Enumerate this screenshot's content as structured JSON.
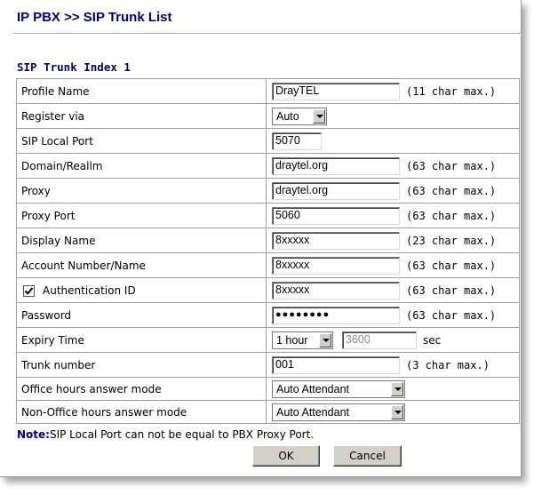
{
  "title": "IP PBX >> SIP Trunk List",
  "section": "SIP Trunk Index 1",
  "rows": {
    "profile_name": {
      "label": "Profile Name",
      "value": "DrayTEL",
      "hint": "(11 char max.)"
    },
    "register_via": {
      "label": "Register via",
      "selected": "Auto"
    },
    "sip_local_port": {
      "label": "SIP Local Port",
      "value": "5070"
    },
    "domain_realm": {
      "label": "Domain/Reallm",
      "value": "draytel.org",
      "hint": "(63 char max.)"
    },
    "proxy": {
      "label": "Proxy",
      "value": "draytel.org",
      "hint": "(63 char max.)"
    },
    "proxy_port": {
      "label": "Proxy Port",
      "value": "5060",
      "hint": "(63 char max.)"
    },
    "display_name": {
      "label": "Display Name",
      "value": "8xxxxx",
      "hint": "(23 char max.)"
    },
    "account_number": {
      "label": "Account Number/Name",
      "value": "8xxxxx",
      "hint": "(63 char max.)"
    },
    "authentication_id": {
      "label": "Authentication ID",
      "checked": true,
      "value": "8xxxxx",
      "hint": "(63 char max.)"
    },
    "password": {
      "label": "Password",
      "value": "●●●●●●●●",
      "hint": "(63 char max.)"
    },
    "expiry_time": {
      "label": "Expiry Time",
      "selected": "1 hour",
      "seconds": "3600",
      "unit": "sec"
    },
    "trunk_number": {
      "label": "Trunk number",
      "value": "001",
      "hint": "(3 char max.)"
    },
    "office_hours_mode": {
      "label": "Office hours answer mode",
      "selected": "Auto Attendant"
    },
    "non_office_hours_mode": {
      "label": "Non-Office hours answer mode",
      "selected": "Auto Attendant"
    }
  },
  "note": {
    "key": "Note:",
    "text": "SIP Local Port can not be equal to PBX Proxy Port."
  },
  "buttons": {
    "ok": "OK",
    "cancel": "Cancel"
  },
  "colors": {
    "title": "#000080",
    "note_key": "#000080",
    "button_face": "#d4d0c8"
  }
}
